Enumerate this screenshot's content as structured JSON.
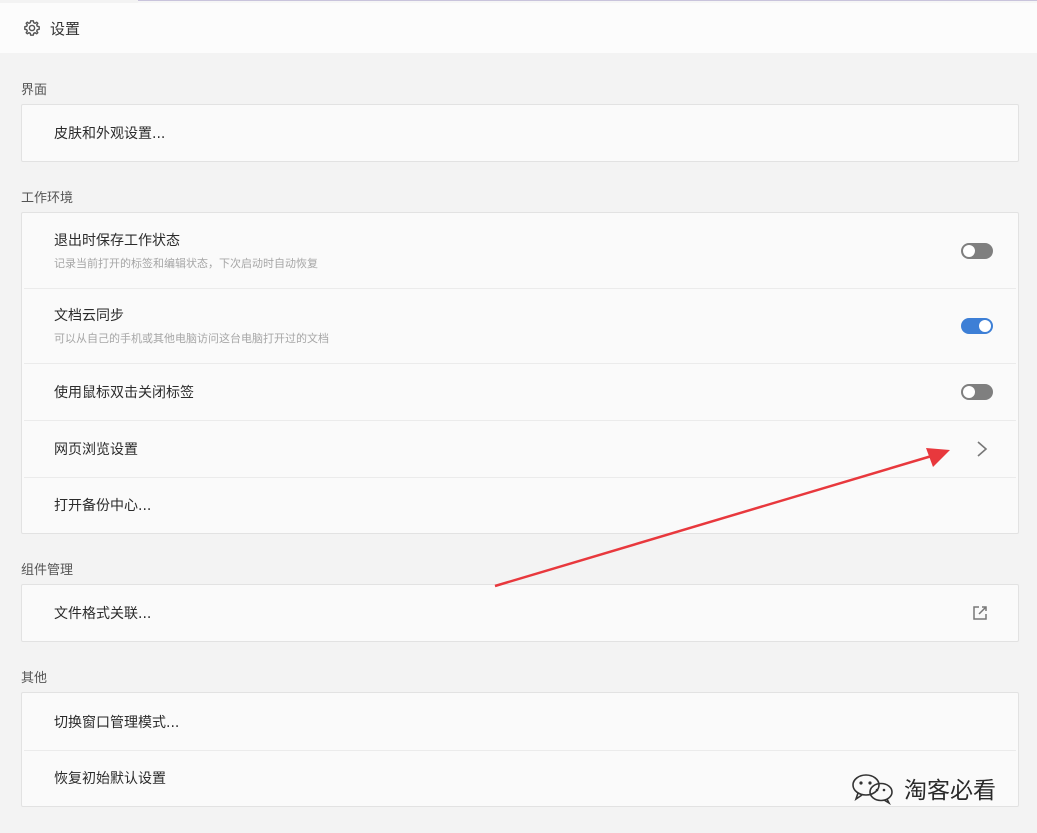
{
  "header": {
    "title": "设置",
    "icon": "gear-icon"
  },
  "sections": {
    "interface": {
      "label": "界面",
      "rows": [
        {
          "label": "皮肤和外观设置..."
        }
      ]
    },
    "workspace": {
      "label": "工作环境",
      "rows": [
        {
          "label": "退出时保存工作状态",
          "desc": "记录当前打开的标签和编辑状态，下次启动时自动恢复",
          "toggle": false
        },
        {
          "label": "文档云同步",
          "desc": "可以从自己的手机或其他电脑访问这台电脑打开过的文档",
          "toggle": true
        },
        {
          "label": "使用鼠标双击关闭标签",
          "toggle": false
        },
        {
          "label": "网页浏览设置",
          "icon": "chevron-right-icon"
        },
        {
          "label": "打开备份中心..."
        }
      ]
    },
    "components": {
      "label": "组件管理",
      "rows": [
        {
          "label": "文件格式关联...",
          "icon": "external-link-icon"
        }
      ]
    },
    "other": {
      "label": "其他",
      "rows": [
        {
          "label": "切换窗口管理模式..."
        },
        {
          "label": "恢复初始默认设置"
        }
      ]
    }
  },
  "watermark": {
    "text": "淘客必看",
    "icon": "wechat-icon"
  },
  "colors": {
    "toggle_on": "#3d7fd6",
    "toggle_off": "#7f7f7f",
    "annotation_arrow": "#e8383d"
  }
}
